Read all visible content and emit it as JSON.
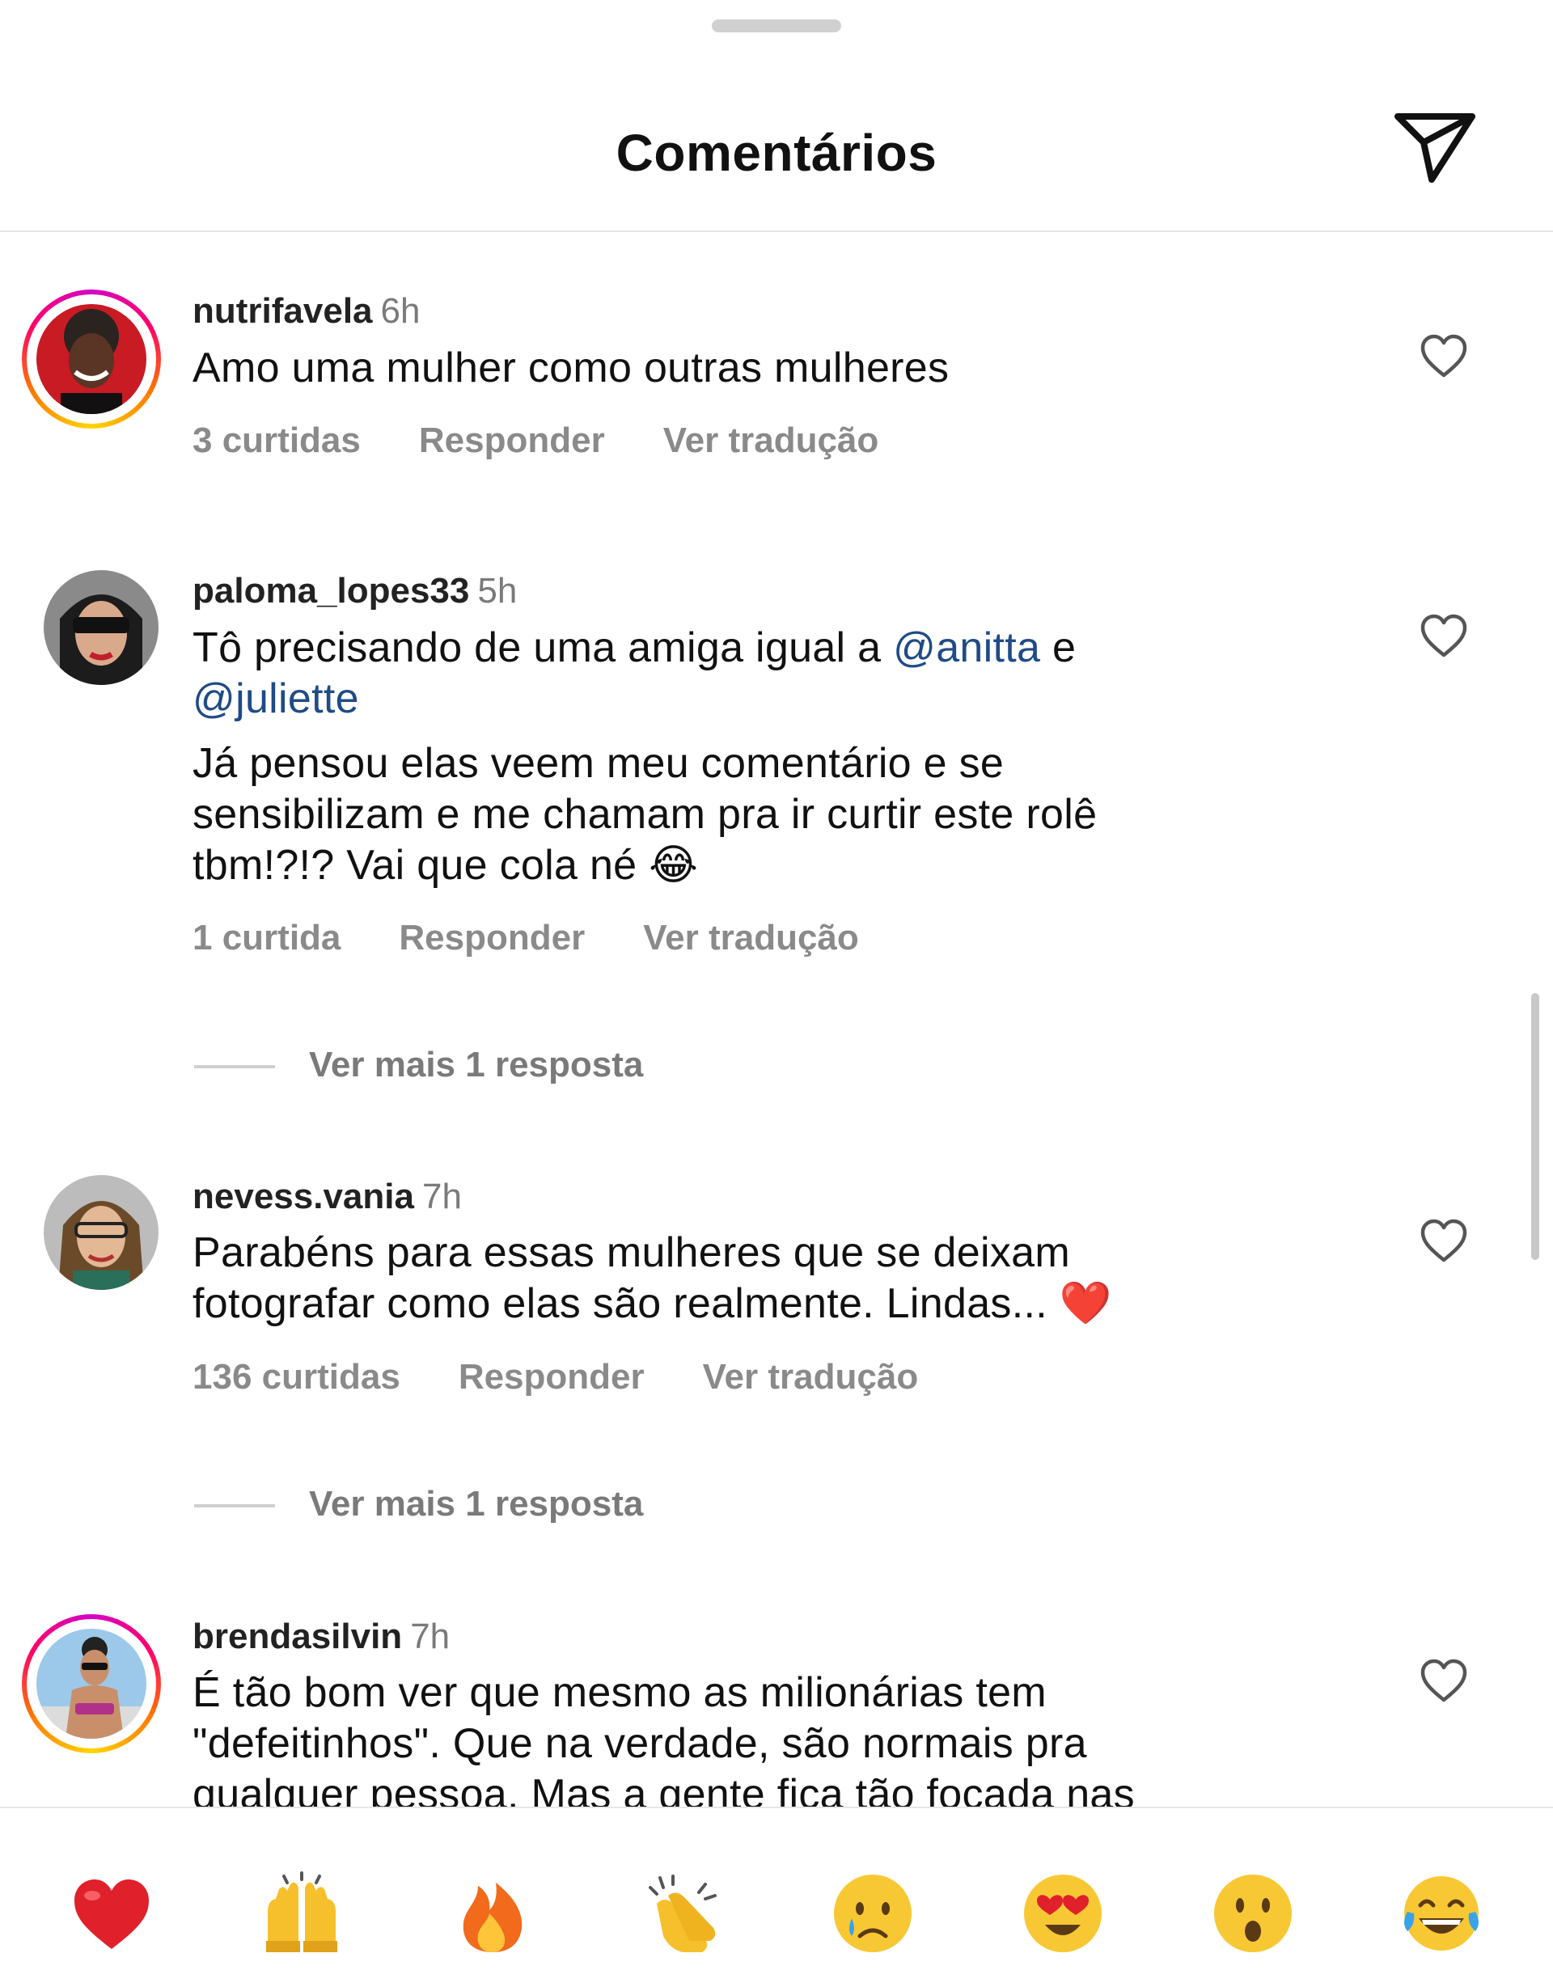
{
  "header": {
    "title": "Comentários"
  },
  "comments": [
    {
      "username": "nutrifavela",
      "time": "6h",
      "lines": [
        "Amo uma mulher como outras mulheres"
      ],
      "likes": "3 curtidas",
      "reply": "Responder",
      "translate": "Ver tradução"
    },
    {
      "username": "paloma_lopes33",
      "time": "5h",
      "line1_pre": "Tô precisando de uma amiga igual a ",
      "mention1": "@anitta",
      "line1_post": " e",
      "mention2": "@juliette",
      "p2_l1": "Já pensou elas veem meu comentário e se",
      "p2_l2": "sensibilizam e me chamam pra ir curtir este rolê",
      "p2_l3": "tbm!?!? Vai que cola né 😂",
      "likes": "1 curtida",
      "reply": "Responder",
      "translate": "Ver tradução",
      "more_replies": "Ver mais 1 resposta"
    },
    {
      "username": "nevess.vania",
      "time": "7h",
      "l1": "Parabéns para essas mulheres que se deixam",
      "l2": "fotografar como elas são realmente. Lindas... ❤️",
      "likes": "136 curtidas",
      "reply": "Responder",
      "translate": "Ver tradução",
      "more_replies": "Ver mais 1 resposta"
    },
    {
      "username": "brendasilvin",
      "time": "7h",
      "l1": "É tão bom ver que mesmo as milionárias tem",
      "l2": "\"defeitinhos\". Que na verdade, são normais pra",
      "l3": "qualquer pessoa. Mas a gente fica tão focada nas"
    }
  ],
  "quick_reactions": [
    {
      "name": "red-heart",
      "glyph": "❤️"
    },
    {
      "name": "raising-hands",
      "glyph": "🙌"
    },
    {
      "name": "fire",
      "glyph": "🔥"
    },
    {
      "name": "clapping-hands",
      "glyph": "👏"
    },
    {
      "name": "crying-face",
      "glyph": "😢"
    },
    {
      "name": "heart-eyes",
      "glyph": "😍"
    },
    {
      "name": "astonished-face",
      "glyph": "😮"
    },
    {
      "name": "tears-of-joy",
      "glyph": "😂"
    }
  ],
  "icons": {
    "share": "paper-plane-icon",
    "like": "heart-outline-icon"
  },
  "colors": {
    "mention": "#1f4b86",
    "story_ring": [
      "#d300c5",
      "#ff0069",
      "#ff7a00",
      "#ffd600"
    ],
    "meta_gray": "#8a8a8a"
  }
}
